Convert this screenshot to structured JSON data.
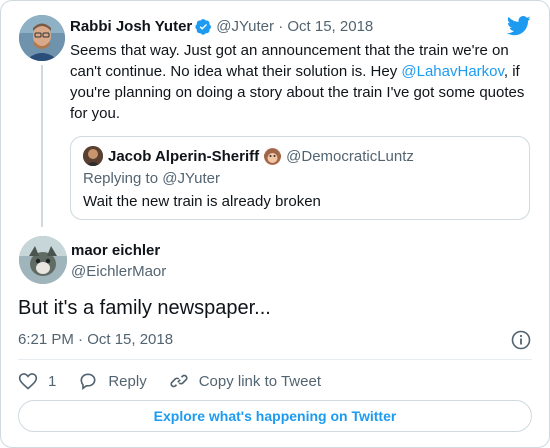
{
  "colors": {
    "accent": "#1d9bf0",
    "text": "#0f1419",
    "muted": "#536471",
    "border": "#cfd9de"
  },
  "parent_tweet": {
    "name": "Rabbi Josh Yuter",
    "verified_icon": "verified-badge-icon",
    "handle": "@JYuter",
    "date": "Oct 15, 2018",
    "text_lines": {
      "before_mention": "Seems that way. Just got an announcement that the train we're on can't continue. No idea what their solution is. Hey ",
      "mention": "@LahavHarkov",
      "after_mention": ", if you're planning on doing a story about the train I've got some quotes for you."
    },
    "quote": {
      "name": "Jacob Alperin-Sheriff",
      "emoji_icon": "monkey-emoji-icon",
      "handle": "@DemocraticLuntz",
      "replying_to": "Replying to @JYuter",
      "text": "Wait the new train is already broken"
    }
  },
  "main_tweet": {
    "name": "maor eichler",
    "handle": "@EichlerMaor",
    "text": "But it's a family newspaper...",
    "timestamp": "6:21 PM · Oct 15, 2018"
  },
  "actions": {
    "like_count": "1",
    "reply_label": "Reply",
    "copy_label": "Copy link to Tweet"
  },
  "explore_label": "Explore what's happening on Twitter",
  "icons": {
    "brand": "twitter-bird-icon",
    "info": "info-icon",
    "like": "heart-icon",
    "reply": "reply-bubble-icon",
    "copy": "link-icon"
  }
}
